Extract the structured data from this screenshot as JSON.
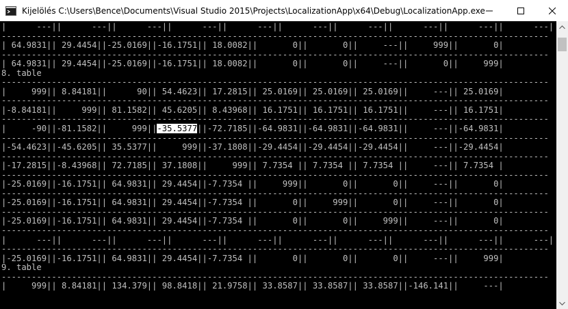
{
  "window": {
    "title": "Kijelölés C:\\Users\\Bence\\Documents\\Visual Studio 2015\\Projects\\LocalizationApp\\x64\\Debug\\LocalizationApp.exe",
    "icon": "console-app-icon",
    "controls": [
      "minimize-icon",
      "maximize-icon",
      "close-icon"
    ]
  },
  "console": {
    "selection": "-35.5377",
    "lines": [
      "|      ---||      ---||      ---||      ---||      ---||      ---||      ---||      ---||      ---||      ---|",
      "-------------------------------------------------------------------------------------------------------------",
      "| 64.9831|| 29.4454||-25.0169||-16.1751|| 18.0082||       0||       0||     ---||     999||       0|",
      "-------------------------------------------------------------------------------------------------------------",
      "| 64.9831|| 29.4454||-25.0169||-16.1751|| 18.0082||       0||       0||     ---||       0||     999|",
      "8. table",
      "-------------------------------------------------------------------------------------------------------------",
      "|     999|| 8.84181||      90|| 54.4623|| 17.2815|| 25.0169|| 25.0169|| 25.0169||     ---|| 25.0169|",
      "-------------------------------------------------------------------------------------------------------------",
      "|-8.84181||     999|| 81.1582|| 45.6205|| 8.43968|| 16.1751|| 16.1751|| 16.1751||     ---|| 16.1751|",
      "-------------------------------------------------------------------------------------------------------------",
      "__ROW_SEL__",
      "-------------------------------------------------------------------------------------------------------------",
      "|-54.4623||-45.6205|| 35.5377||     999||-37.1808||-29.4454||-29.4454||-29.4454||     ---||-29.4454|",
      "-------------------------------------------------------------------------------------------------------------",
      "|-17.2815||-8.43968|| 72.7185|| 37.1808||     999|| 7.7354 || 7.7354 || 7.7354 ||     ---|| 7.7354 |",
      "-------------------------------------------------------------------------------------------------------------",
      "|-25.0169||-16.1751|| 64.9831|| 29.4454||-7.7354 ||     999||       0||       0||     ---||       0|",
      "-------------------------------------------------------------------------------------------------------------",
      "|-25.0169||-16.1751|| 64.9831|| 29.4454||-7.7354 ||       0||     999||       0||     ---||       0|",
      "-------------------------------------------------------------------------------------------------------------",
      "|-25.0169||-16.1751|| 64.9831|| 29.4454||-7.7354 ||       0||       0||     999||     ---||       0|",
      "-------------------------------------------------------------------------------------------------------------",
      "|      ---||      ---||      ---||      ---||      ---||      ---||      ---||      ---||      ---||      ---|",
      "-------------------------------------------------------------------------------------------------------------",
      "|-25.0169||-16.1751|| 64.9831|| 29.4454||-7.7354 ||       0||       0||       0||     ---||     999|",
      "9. table",
      "-------------------------------------------------------------------------------------------------------------",
      "|     999|| 8.84181|| 134.379|| 98.8418|| 21.9758|| 33.8587|| 33.8587|| 33.8587||-146.141||     ---|"
    ],
    "sel_row": {
      "before": "|     -90||-81.1582||     999||",
      "after": "||-72.7185||-64.9831||-64.9831||-64.9831||     ---||-64.9831|"
    }
  },
  "scrollbar": {
    "up": "scroll-up-arrow-icon",
    "down": "scroll-down-arrow-icon"
  }
}
